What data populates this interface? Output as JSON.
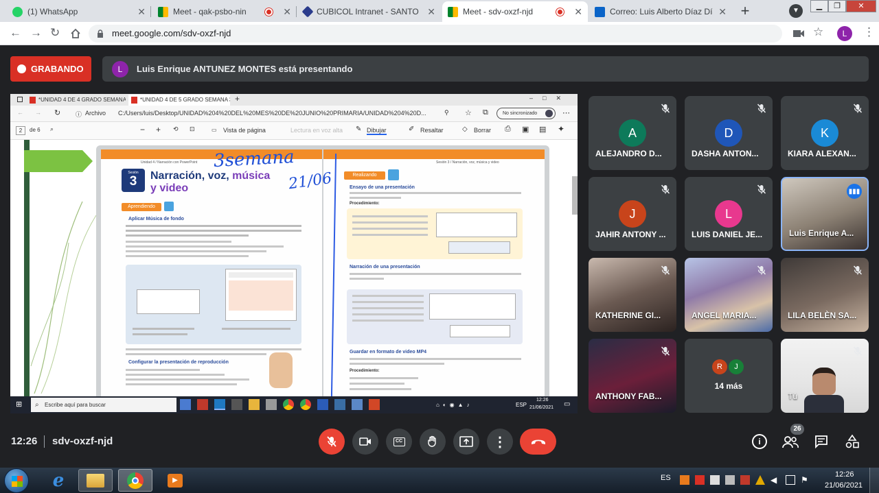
{
  "browser": {
    "tabs": [
      {
        "title": "(1) WhatsApp"
      },
      {
        "title": "Meet - qak-psbo-nin"
      },
      {
        "title": "CUBICOL Intranet - SANTO DOMINGO"
      },
      {
        "title": "Meet - sdv-oxzf-njd"
      },
      {
        "title": "Correo: Luis Alberto Díaz Díaz"
      }
    ],
    "url": "meet.google.com/sdv-oxzf-njd",
    "profile_initial": "L"
  },
  "meet": {
    "recording_label": "GRABANDO",
    "presenter_initial": "L",
    "presenting_text": "Luis Enrique ANTUNEZ MONTES está presentando",
    "time": "12:26",
    "meeting_code": "sdv-oxzf-njd",
    "participant_count": "26",
    "more_initials": [
      "R",
      "J"
    ],
    "more_label": "14 más",
    "participants": [
      {
        "name": "ALEJANDRO D...",
        "initial": "A",
        "color": "#0d7a5a"
      },
      {
        "name": "DASHA ANTON...",
        "initial": "D",
        "color": "#1f56b8"
      },
      {
        "name": "KIARA ALEXAN...",
        "initial": "K",
        "color": "#1a8ad6"
      },
      {
        "name": "JAHIR ANTONY ...",
        "initial": "J",
        "color": "#c8441b"
      },
      {
        "name": "LUIS DANIEL JE...",
        "initial": "L",
        "color": "#e8388e"
      },
      {
        "name": "Luis Enrique A...",
        "initial": "",
        "color": ""
      },
      {
        "name": "KATHERINE GI...",
        "initial": "",
        "color": ""
      },
      {
        "name": "ANGEL MARIA...",
        "initial": "",
        "color": ""
      },
      {
        "name": "LILA BELÈN SA...",
        "initial": "",
        "color": ""
      },
      {
        "name": "ANTHONY FAB...",
        "initial": "",
        "color": ""
      },
      {
        "name": "",
        "initial": "",
        "color": ""
      },
      {
        "name": "Tú",
        "initial": "",
        "color": ""
      }
    ]
  },
  "shared": {
    "tabs": [
      {
        "title": "*UNIDAD 4 DE 4 GRADO SEMANA 2..."
      },
      {
        "title": "*UNIDAD 4 DE 5 GRADO SEMANA 3..."
      }
    ],
    "archivo": "Archivo",
    "path": "C:/Users/luis/Desktop/UNIDAD%204%20DEL%20MES%20DE%20JUNIO%20PRIMARIA/UNIDAD%204%20D...",
    "sync": "No sincronizado",
    "page_current": "2",
    "page_total": "de 6",
    "toolbar": {
      "vista": "Vista de página",
      "lectura": "Lectura en voz alta",
      "dibujar": "Dibujar",
      "resaltar": "Resaltar",
      "borrar": "Borrar"
    },
    "doc": {
      "handwriting_top": "3semana",
      "handwriting_date": "21/06",
      "unit_left": "Unidad 4 / Narración con PowerPoint",
      "unit_right": "Sesión 3 / Narración, voz, música y video",
      "sesion_label": "Sesión",
      "sesion_number": "3",
      "title_a": "Narración, voz,",
      "title_b": "música",
      "title_c": "y video",
      "aprendiendo": "Aprendiendo",
      "realizando": "Realizando",
      "h_musica": "Aplicar Música de fondo",
      "h_configurar": "Configurar la presentación de reproducción",
      "h_ensayo": "Ensayo de una presentación",
      "h_narracion": "Narración de una presentación",
      "h_video": "Guardar en formato de video MP4",
      "procedimiento": "Procedimiento:"
    },
    "win_taskbar": {
      "search": "Escribe aquí para buscar",
      "lang": "ESP",
      "time": "12:26",
      "date": "21/06/2021"
    }
  },
  "taskbar": {
    "lang": "ES",
    "time": "12:26",
    "date": "21/06/2021"
  },
  "colors": {
    "record": "#d93025",
    "meet_bg": "#202124",
    "tile": "#3c4043",
    "hangup": "#ea4335",
    "book_orange": "#f28c28"
  }
}
